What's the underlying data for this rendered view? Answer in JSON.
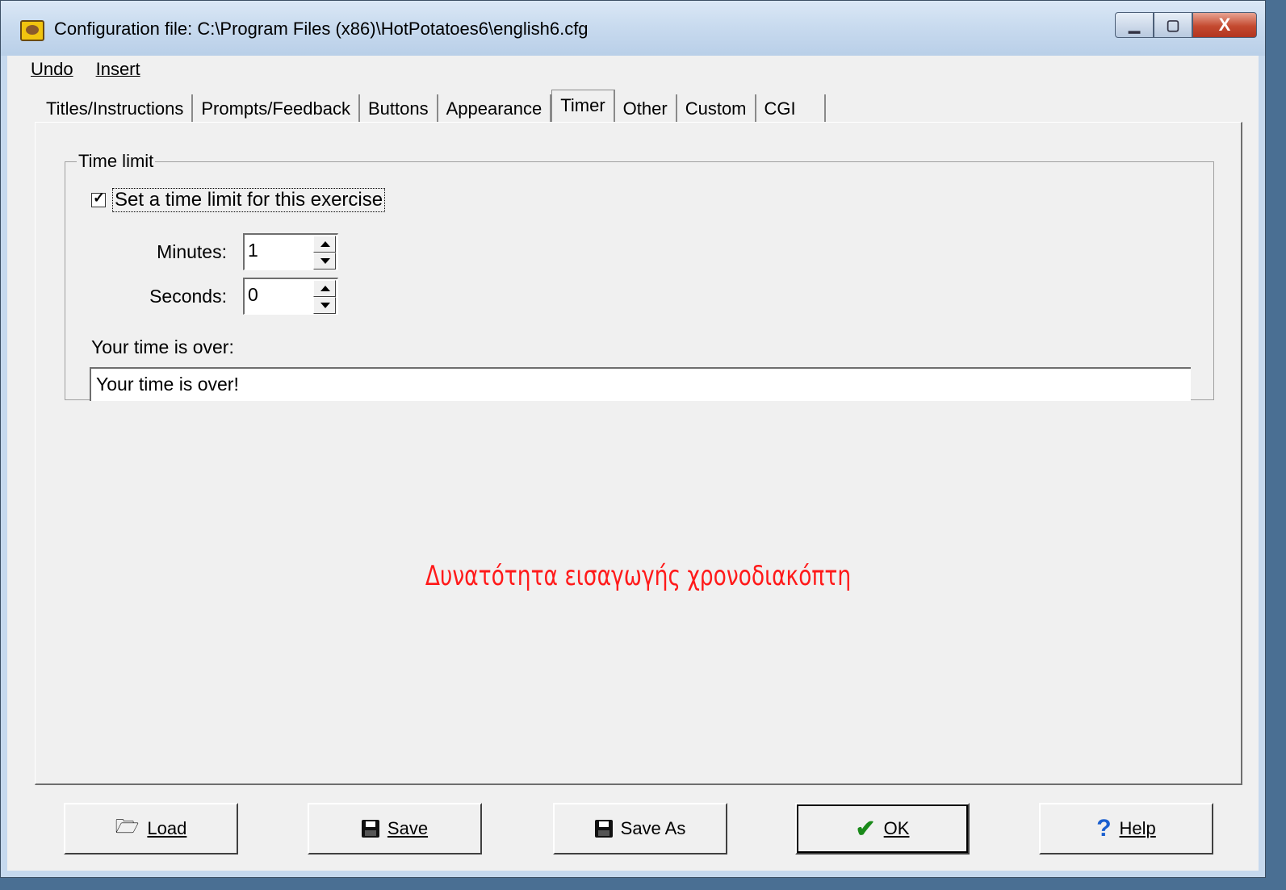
{
  "window": {
    "title": "Configuration file: C:\\Program Files (x86)\\HotPotatoes6\\english6.cfg",
    "controls": {
      "minimize": "▁",
      "maximize": "▢",
      "close": "X"
    }
  },
  "menu": {
    "items": [
      "Undo",
      "Insert"
    ]
  },
  "tabs": [
    {
      "label": "Titles/Instructions"
    },
    {
      "label": "Prompts/Feedback"
    },
    {
      "label": "Buttons"
    },
    {
      "label": "Appearance"
    },
    {
      "label": "Timer",
      "active": true
    },
    {
      "label": "Other"
    },
    {
      "label": "Custom"
    },
    {
      "label": "CGI"
    }
  ],
  "timer": {
    "group_label": "Time limit",
    "checkbox_label": "Set a time limit for this exercise",
    "checkbox_checked": true,
    "minutes_label": "Minutes:",
    "minutes_value": "1",
    "seconds_label": "Seconds:",
    "seconds_value": "0",
    "time_over_label": "Your time is over:",
    "time_over_value": "Your time is over!"
  },
  "annotation": "Δυνατότητα εισαγωγής χρονοδιακόπτη",
  "buttons": {
    "load": "Load",
    "save": "Save",
    "save_as": "Save As",
    "ok": "OK",
    "help": "Help"
  },
  "colors": {
    "annotation": "#ff1a1a",
    "ok_check": "#1a8a1a",
    "help_icon": "#1a5fcf"
  },
  "icons": {
    "load": "open-folder-icon",
    "save": "floppy-disk-icon",
    "save_as": "floppy-disk-question-icon",
    "ok": "checkmark-icon",
    "help": "question-mark-icon"
  }
}
